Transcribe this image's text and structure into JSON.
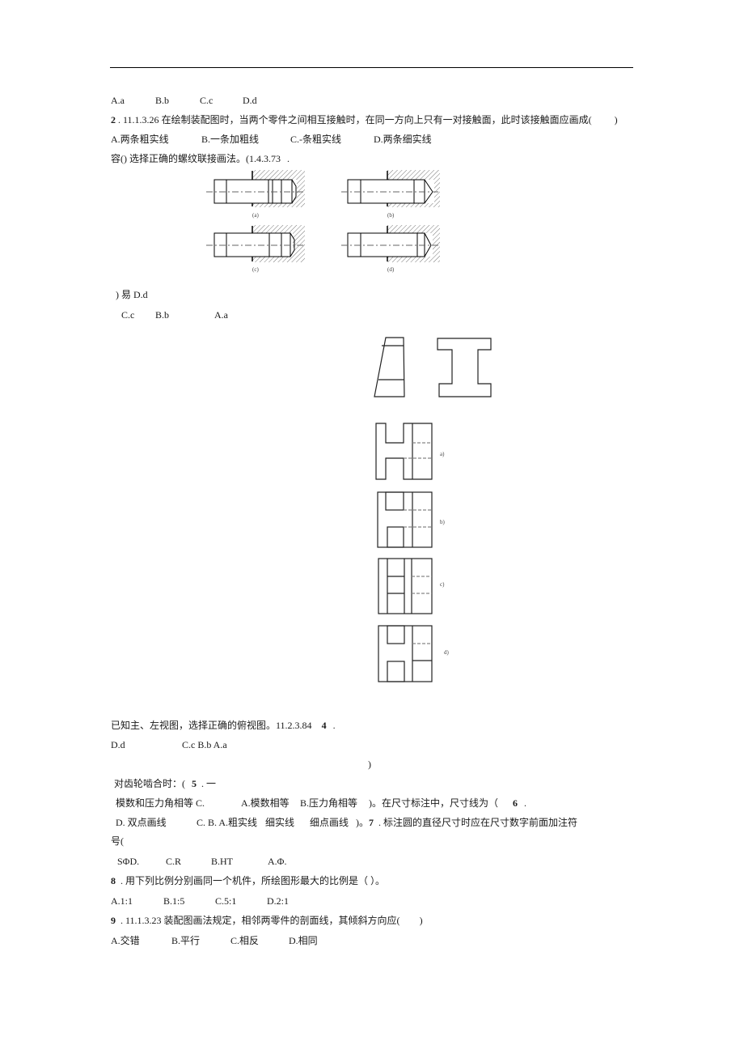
{
  "header_rule": true,
  "q1_options": [
    "A.a",
    "B.b",
    "C.c",
    "D.d"
  ],
  "q2": {
    "number": "2",
    "code": "11.1.3.26",
    "stem": "在绘制装配图时，当两个零件之间相互接触时，在同一方向上只有一对接触面，此时该接触面应画成(",
    "close": ")",
    "options": [
      "A.两条粗实线",
      "B.一条加粗线",
      "C.-条粗实线",
      "D.两条细实线"
    ]
  },
  "q3": {
    "stem": "容()   选择正确的螺纹联接画法。(1.4.3.73",
    "tail": ".",
    "figure_captions": [
      "(a)",
      "(b)",
      "(c)",
      "(d)"
    ],
    "answer_line1": ") 易 D.d",
    "answer_options": [
      "C.c",
      "B.b",
      "A.a"
    ]
  },
  "q4": {
    "view_captions": [
      "a)",
      "b)",
      "c)",
      "d)"
    ],
    "stem": "已知主、左视图，选择正确的俯视图。11.2.3.84",
    "number": "4",
    "dot": ".",
    "options_line": [
      "D.d",
      "C.c B.b A.a"
    ],
    "close": ")"
  },
  "q5": {
    "line1": "对齿轮啮合时：(",
    "number": "5",
    "line1_tail": ". 一",
    "line2_parts": [
      "模数和压力角相等 C.",
      "A.模数相等",
      "B.压力角相等",
      ")。在尺寸标注中，尺寸线为（"
    ],
    "q6_number": "6",
    "q6_dot": "."
  },
  "q6_q7": {
    "line3_parts": [
      "D. 双点画线",
      "C. B. A.粗实线",
      "细实线",
      "细点画线",
      ")。"
    ],
    "q7_number": "7",
    "q7_text": ". 标注圆的直径尺寸时应在尺寸数字前面加注符",
    "q7_cont": "号(",
    "q7_options": [
      "SΦD.",
      "C.R",
      "B.HT",
      "A.Φ."
    ]
  },
  "q8": {
    "number": "8",
    "stem": ". 用下列比例分别画同一个机件，所绘图形最大的比例是（        ）。",
    "options": [
      "A.1:1",
      "B.1:5",
      "C.5:1",
      "D.2:1"
    ]
  },
  "q9": {
    "number": "9",
    "stem": ". 11.1.3.23 装配图画法规定，相邻两零件的剖面线，其倾斜方向应(",
    "close": ")",
    "options": [
      "A.交错",
      "B.平行",
      "C.相反",
      "D.相同"
    ]
  }
}
